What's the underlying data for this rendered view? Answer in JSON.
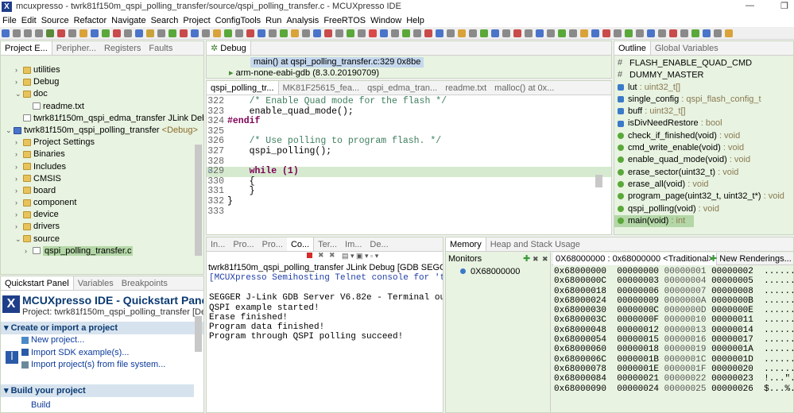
{
  "window": {
    "title": "mcuxpresso - twrk81f150m_qspi_polling_transfer/source/qspi_polling_transfer.c - MCUXpresso IDE",
    "logo": "X"
  },
  "menu": [
    "File",
    "Edit",
    "Source",
    "Refactor",
    "Navigate",
    "Search",
    "Project",
    "ConfigTools",
    "Run",
    "Analysis",
    "FreeRTOS",
    "Window",
    "Help"
  ],
  "project_explorer": {
    "tabs": [
      "Project E...",
      "Peripher...",
      "Registers",
      "Faults"
    ],
    "items": [
      {
        "label": "utilities",
        "indent": 1,
        "kind": "folder",
        "chev": "›"
      },
      {
        "label": "Debug",
        "indent": 1,
        "kind": "folder",
        "chev": "›"
      },
      {
        "label": "doc",
        "indent": 1,
        "kind": "folder",
        "chev": "⌄"
      },
      {
        "label": "readme.txt",
        "indent": 2,
        "kind": "file",
        "chev": ""
      },
      {
        "label": "twrk81f150m_qspi_edma_transfer JLink Debug.l",
        "indent": 1,
        "kind": "file",
        "chev": ""
      },
      {
        "label": "twrk81f150m_qspi_polling_transfer",
        "suffix": " <Debug>",
        "indent": 0,
        "kind": "proj",
        "chev": "⌄"
      },
      {
        "label": "Project Settings",
        "indent": 1,
        "kind": "folder",
        "chev": "›"
      },
      {
        "label": "Binaries",
        "indent": 1,
        "kind": "folder",
        "chev": "›"
      },
      {
        "label": "Includes",
        "indent": 1,
        "kind": "folder",
        "chev": "›"
      },
      {
        "label": "CMSIS",
        "indent": 1,
        "kind": "folder",
        "chev": "›"
      },
      {
        "label": "board",
        "indent": 1,
        "kind": "folder",
        "chev": "›"
      },
      {
        "label": "component",
        "indent": 1,
        "kind": "folder",
        "chev": "›"
      },
      {
        "label": "device",
        "indent": 1,
        "kind": "folder",
        "chev": "›"
      },
      {
        "label": "drivers",
        "indent": 1,
        "kind": "folder",
        "chev": "›"
      },
      {
        "label": "source",
        "indent": 1,
        "kind": "folder",
        "chev": "⌄"
      },
      {
        "label": "qspi_polling_transfer.c",
        "indent": 2,
        "kind": "file",
        "chev": "›",
        "selected": true
      }
    ]
  },
  "quickstart": {
    "tabs": [
      "Quickstart Panel",
      "Variables",
      "Breakpoints"
    ],
    "title": "MCUXpresso IDE - Quickstart Pane",
    "project_line": "Project: twrk81f150m_qspi_polling_transfer [Debu",
    "section1": "Create or import a project",
    "links": [
      "New project...",
      "Import SDK example(s)...",
      "Import project(s) from file system..."
    ],
    "section2": "Build your project",
    "build": "Build"
  },
  "debug": {
    "tab": "Debug",
    "frame": "main() at qspi_polling_transfer.c:329 0x8be",
    "gdb": "arm-none-eabi-gdb (8.3.0.20190709)"
  },
  "editor": {
    "tabs": [
      "qspi_polling_tr...",
      "MK81F25615_fea...",
      "qspi_edma_tran...",
      "readme.txt",
      "malloc() at 0x..."
    ],
    "lines": [
      {
        "num": "322",
        "text": "    /* Enable Quad mode for the flash */",
        "cls": "cm"
      },
      {
        "num": "323",
        "text": "    enable_quad_mode();",
        "cls": ""
      },
      {
        "num": "324",
        "text": "#endif",
        "cls": "pp"
      },
      {
        "num": "325",
        "text": "",
        "cls": ""
      },
      {
        "num": "326",
        "text": "    /* Use polling to program flash. */",
        "cls": "cm"
      },
      {
        "num": "327",
        "text": "    qspi_polling();",
        "cls": ""
      },
      {
        "num": "328",
        "text": "",
        "cls": ""
      },
      {
        "num": "329",
        "text": "    while (1)",
        "cls": "kwline",
        "current": true
      },
      {
        "num": "330",
        "text": "    {",
        "cls": ""
      },
      {
        "num": "331",
        "text": "    }",
        "cls": ""
      },
      {
        "num": "332",
        "text": "}",
        "cls": ""
      },
      {
        "num": "333",
        "text": "",
        "cls": ""
      }
    ]
  },
  "outline": {
    "tabs": [
      "Outline",
      "Global Variables"
    ],
    "items": [
      {
        "name": "FLASH_ENABLE_QUAD_CMD",
        "type": "",
        "icon": "#"
      },
      {
        "name": "DUMMY_MASTER",
        "type": "",
        "icon": "#"
      },
      {
        "name": "lut",
        "type": " : uint32_t[]",
        "icon": "var"
      },
      {
        "name": "single_config",
        "type": " : qspi_flash_config_t",
        "icon": "var"
      },
      {
        "name": "buff",
        "type": " : uint32_t[]",
        "icon": "var"
      },
      {
        "name": "isDivNeedRestore",
        "type": " : bool",
        "icon": "var"
      },
      {
        "name": "check_if_finished(void)",
        "type": " : void",
        "icon": "fn"
      },
      {
        "name": "cmd_write_enable(void)",
        "type": " : void",
        "icon": "fn"
      },
      {
        "name": "enable_quad_mode(void)",
        "type": " : void",
        "icon": "fn"
      },
      {
        "name": "erase_sector(uint32_t)",
        "type": " : void",
        "icon": "fn"
      },
      {
        "name": "erase_all(void)",
        "type": " : void",
        "icon": "fn"
      },
      {
        "name": "program_page(uint32_t, uint32_t*)",
        "type": " : void",
        "icon": "fn"
      },
      {
        "name": "qspi_polling(void)",
        "type": " : void",
        "icon": "fn"
      },
      {
        "name": "main(void)",
        "type": " : int",
        "icon": "fn",
        "selected": true
      }
    ]
  },
  "console": {
    "tabs": [
      "In...",
      "Pro...",
      "Pro...",
      "Co...",
      "Ter...",
      "Im...",
      "De..."
    ],
    "header": "twrk81f150m_qspi_polling_transfer JLink Debug [GDB SEGGER Interfa",
    "semihost": "[MCUXpresso Semihosting Telnet console for 'twr",
    "lines": [
      "",
      "SEGGER J-Link GDB Server V6.82e - Terminal outp",
      "QSPI example started!",
      "Erase finished!",
      "Program data finished!",
      "Program through QSPI polling succeed!"
    ]
  },
  "memory": {
    "tabs": [
      "Memory",
      "Heap and Stack Usage"
    ],
    "monitors_label": "Monitors",
    "monitor": "0X68000000",
    "rendering_tab": "0X68000000 : 0x68000000 <Traditional>",
    "new_rendering": "New Renderings...",
    "rows": [
      {
        "addr": "0x68000000",
        "w": [
          "00000000",
          "00000001",
          "00000002"
        ],
        "asc": "............"
      },
      {
        "addr": "0x6800000C",
        "w": [
          "00000003",
          "00000004",
          "00000005"
        ],
        "asc": "............"
      },
      {
        "addr": "0x68000018",
        "w": [
          "00000006",
          "00000007",
          "00000008"
        ],
        "asc": "............"
      },
      {
        "addr": "0x68000024",
        "w": [
          "00000009",
          "0000000A",
          "0000000B"
        ],
        "asc": "............"
      },
      {
        "addr": "0x68000030",
        "w": [
          "0000000C",
          "0000000D",
          "0000000E"
        ],
        "asc": "............"
      },
      {
        "addr": "0x6800003C",
        "w": [
          "0000000F",
          "00000010",
          "00000011"
        ],
        "asc": "............"
      },
      {
        "addr": "0x68000048",
        "w": [
          "00000012",
          "00000013",
          "00000014"
        ],
        "asc": "............"
      },
      {
        "addr": "0x68000054",
        "w": [
          "00000015",
          "00000016",
          "00000017"
        ],
        "asc": "............"
      },
      {
        "addr": "0x68000060",
        "w": [
          "00000018",
          "00000019",
          "0000001A"
        ],
        "asc": "............"
      },
      {
        "addr": "0x6800006C",
        "w": [
          "0000001B",
          "0000001C",
          "0000001D"
        ],
        "asc": "............"
      },
      {
        "addr": "0x68000078",
        "w": [
          "0000001E",
          "0000001F",
          "00000020"
        ],
        "asc": "........... "
      },
      {
        "addr": "0x68000084",
        "w": [
          "00000021",
          "00000022",
          "00000023"
        ],
        "asc": "!...\"...#..."
      },
      {
        "addr": "0x68000090",
        "w": [
          "00000024",
          "00000025",
          "00000026"
        ],
        "asc": "$...%...&..."
      }
    ]
  },
  "colors": {
    "panel_bg": "#e8f3e1",
    "selection": "#b4d7a7",
    "current_line": "#d6ead0",
    "link": "#0b3a9a",
    "brand": "#0b3a72"
  }
}
